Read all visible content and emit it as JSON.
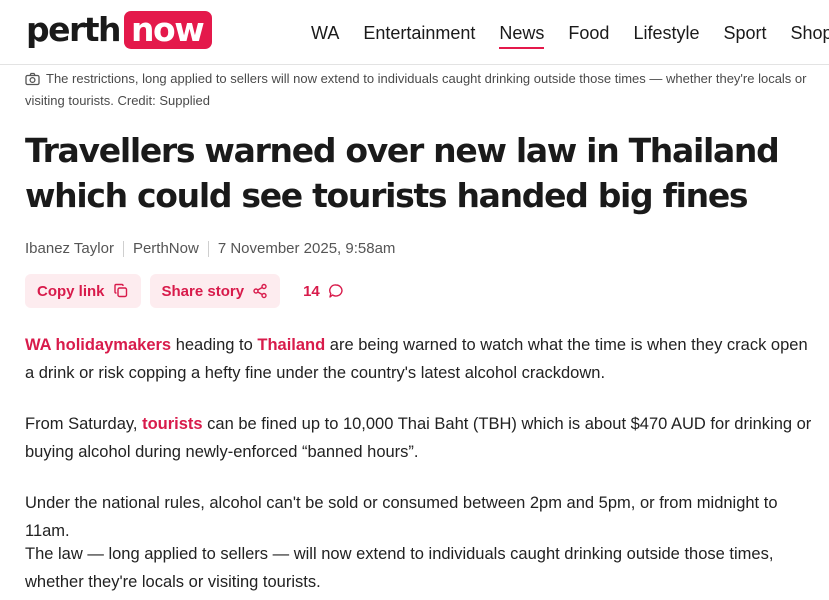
{
  "header": {
    "logo": {
      "part1": "perth",
      "part2": "now"
    },
    "nav": [
      "WA",
      "Entertainment",
      "News",
      "Food",
      "Lifestyle",
      "Sport",
      "ShopNow"
    ],
    "active_nav": "News"
  },
  "caption": "The restrictions, long applied to sellers will now extend to individuals caught drinking outside those times — whether they're locals or visiting tourists. Credit: Supplied",
  "headline": "Travellers warned over new law in Thailand which could see tourists handed big fines",
  "byline": {
    "author": "Ibanez Taylor",
    "source": "PerthNow",
    "date": "7 November 2025, 9:58am"
  },
  "actions": {
    "copy_link": "Copy link",
    "share_story": "Share story",
    "comment_count": "14"
  },
  "body": {
    "p1": {
      "link1": "WA holidaymakers",
      "text1": " heading to ",
      "link2": "Thailand",
      "text2": " are being warned to watch what the time is when they crack open a drink or risk copping a hefty fine under the country's latest alcohol crackdown."
    },
    "p2": {
      "text1": "From Saturday, ",
      "link1": "tourists",
      "text2": " can be fined up to 10,000 Thai Baht (TBH) which is about $470 AUD for drinking or buying alcohol during newly-enforced “banned hours”."
    },
    "p3": "Under the national rules, alcohol can't be sold or consumed between 2pm and 5pm, or from midnight to 11am.",
    "p4": "The law — long applied to sellers — will now extend to individuals caught drinking outside those times, whether they're locals or visiting tourists."
  },
  "colors": {
    "brand": "#e4194b",
    "link": "#d81b4b",
    "button_bg": "#fdecef"
  }
}
